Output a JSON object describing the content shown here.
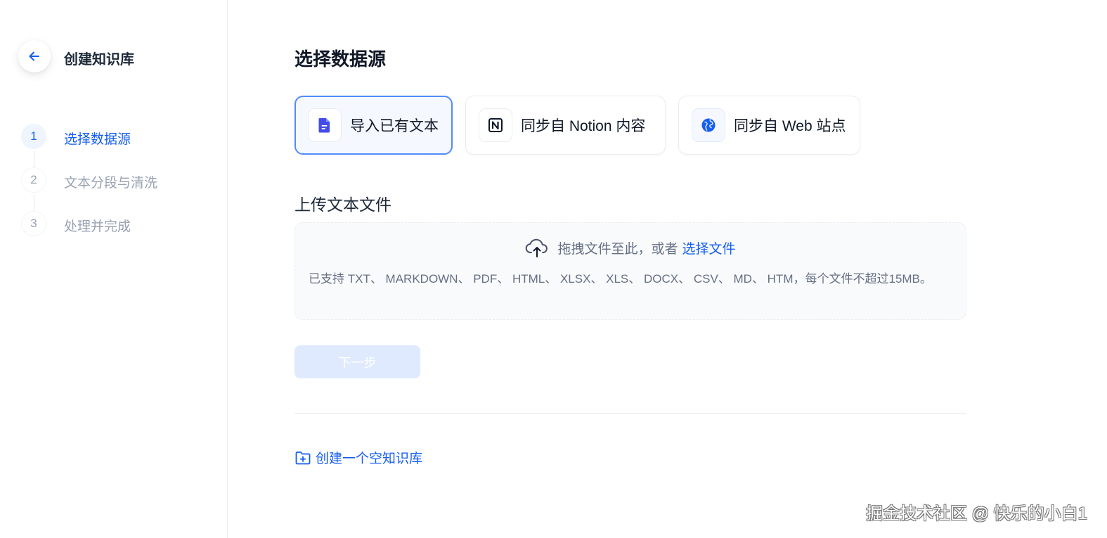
{
  "sidebar": {
    "back_icon": "arrow-left-icon",
    "title": "创建知识库",
    "steps": [
      {
        "num": "1",
        "label": "选择数据源",
        "active": true
      },
      {
        "num": "2",
        "label": "文本分段与清洗",
        "active": false
      },
      {
        "num": "3",
        "label": "处理并完成",
        "active": false
      }
    ]
  },
  "main": {
    "title": "选择数据源",
    "sources": [
      {
        "label": "导入已有文本",
        "icon": "document-icon",
        "selected": true
      },
      {
        "label": "同步自 Notion 内容",
        "icon": "notion-icon",
        "selected": false
      },
      {
        "label": "同步自 Web 站点",
        "icon": "globe-icon",
        "selected": false
      }
    ],
    "upload": {
      "section_title": "上传文本文件",
      "drag_text": "拖拽文件至此，或者",
      "pick_link": "选择文件",
      "tip": "已支持 TXT、 MARKDOWN、 PDF、 HTML、 XLSX、 XLS、 DOCX、 CSV、 MD、 HTM，每个文件不超过15MB。"
    },
    "next_button": "下一步",
    "create_empty": "创建一个空知识库"
  },
  "watermark": "掘金技术社区 @ 快乐的小白1",
  "colors": {
    "accent": "#155eef",
    "selected_border": "#528bff",
    "disabled_button": "#e0eaff",
    "muted_text": "#98a2b3"
  }
}
